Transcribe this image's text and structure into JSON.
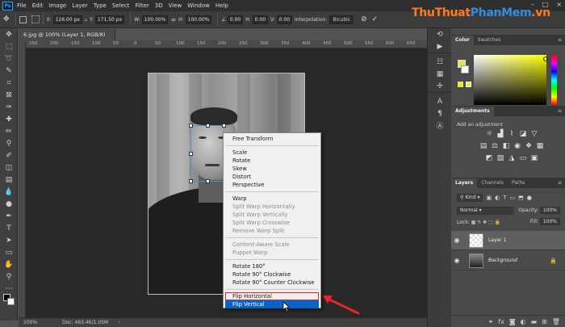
{
  "app": {
    "logo": "Ps",
    "menu": [
      "File",
      "Edit",
      "Image",
      "Layer",
      "Type",
      "Select",
      "Filter",
      "3D",
      "View",
      "Window",
      "Help"
    ],
    "window_controls": [
      "–",
      "□",
      "×"
    ]
  },
  "watermark": {
    "part_a": "ThuThuat",
    "part_b": "PhanMem",
    "part_c": ".vn"
  },
  "options": {
    "x_label": "X:",
    "x_value": "126.00 px",
    "y_label": "Y:",
    "y_value": "171.50 px",
    "w_label": "W:",
    "w_value": "100.00%",
    "h_label": "H:",
    "h_value": "100.00%",
    "angle_value": "0.00",
    "h_skew_label": "H:",
    "h_skew_value": "0.00",
    "v_skew_label": "V:",
    "v_skew_value": "0.00",
    "interp_label": "Interpolation:",
    "interp_value": "Bicubic",
    "commit": "✓",
    "cancel": "⊘"
  },
  "document": {
    "tab_title": "6.jpg @ 100% (Layer 1, RGB/8) *",
    "ruler_labels": [
      "250",
      "200",
      "150",
      "100",
      "50",
      "0",
      "50",
      "100",
      "150",
      "200",
      "250",
      "300",
      "350",
      "400",
      "450",
      "500",
      "550",
      "600",
      "650"
    ]
  },
  "context_menu": {
    "groups": [
      [
        {
          "label": "Free Transform",
          "enabled": true
        }
      ],
      [
        {
          "label": "Scale",
          "enabled": true
        },
        {
          "label": "Rotate",
          "enabled": true
        },
        {
          "label": "Skew",
          "enabled": true
        },
        {
          "label": "Distort",
          "enabled": true
        },
        {
          "label": "Perspective",
          "enabled": true
        }
      ],
      [
        {
          "label": "Warp",
          "enabled": true
        },
        {
          "label": "Split Warp Horizontally",
          "enabled": false
        },
        {
          "label": "Split Warp Vertically",
          "enabled": false
        },
        {
          "label": "Split Warp Crosswise",
          "enabled": false
        },
        {
          "label": "Remove Warp Split",
          "enabled": false
        }
      ],
      [
        {
          "label": "Content-Aware Scale",
          "enabled": false
        },
        {
          "label": "Puppet Warp",
          "enabled": false
        }
      ],
      [
        {
          "label": "Rotate 180°",
          "enabled": true
        },
        {
          "label": "Rotate 90° Clockwise",
          "enabled": true
        },
        {
          "label": "Rotate 90° Counter Clockwise",
          "enabled": true
        }
      ]
    ],
    "flip_horizontal": "Flip Horizontal",
    "flip_vertical": "Flip Vertical"
  },
  "status": {
    "zoom": "100%",
    "doc": "Doc: 463.4K/1.05M",
    "arrow": "›"
  },
  "panels": {
    "color_tabs": [
      "Color",
      "Swatches"
    ],
    "adjustments_tab": "Adjustments",
    "adjust_subtitle": "Add an adjustment",
    "layers_tabs": [
      "Layers",
      "Channels",
      "Paths"
    ],
    "kind_filter": "Kind",
    "blend_mode": "Normal",
    "opacity_label": "Opacity:",
    "opacity_value": "100%",
    "lock_label": "Lock:",
    "fill_label": "Fill:",
    "fill_value": "100%",
    "layers": [
      {
        "name": "Layer 1",
        "selected": true
      },
      {
        "name": "Background",
        "selected": false
      }
    ],
    "fg_color": "#e7e84a",
    "bg_color": "#ffffff"
  },
  "colors": {
    "highlight_blue": "#0a64c8",
    "annotation_red": "#e3272d"
  }
}
